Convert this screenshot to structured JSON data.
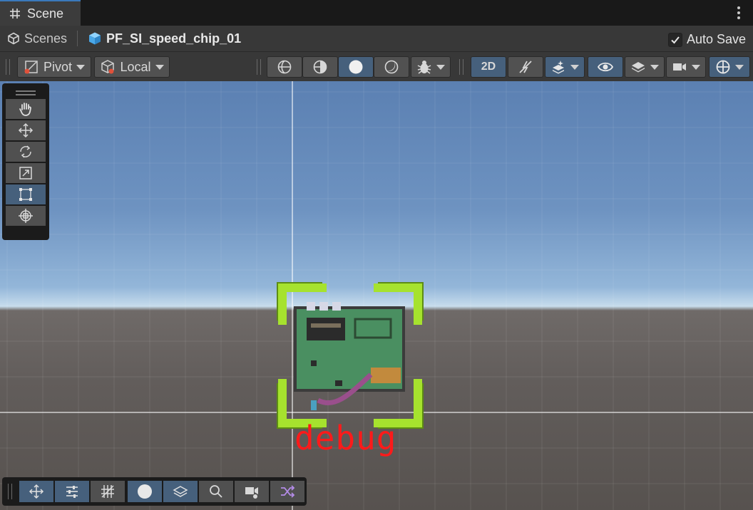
{
  "tab": {
    "title": "Scene",
    "icon": "grid-hash-icon",
    "menu_icon": "kebab-menu-icon"
  },
  "breadcrumb": {
    "scenes_label": "Scenes",
    "prefab_label": "PF_SI_speed_chip_01"
  },
  "autosave": {
    "label": "Auto Save",
    "checked": true
  },
  "toolbar": {
    "pivot_label": "Pivot",
    "local_label": "Local",
    "mode_2d_label": "2D",
    "draw_modes": [
      "wireframe",
      "shaded-wireframe",
      "shaded",
      "unlit"
    ],
    "active_draw_mode": "shaded"
  },
  "tools": {
    "items": [
      "hand-tool",
      "move-tool",
      "rotate-tool",
      "scale-tool",
      "rect-tool",
      "transform-tool"
    ],
    "active": "rect-tool"
  },
  "bottom_overlay": {
    "items": [
      "move-overlay",
      "settings-overlay",
      "grid-overlay",
      "shading-overlay",
      "layers-overlay",
      "search-overlay",
      "camera-overlay",
      "shuffle-overlay"
    ]
  },
  "scene": {
    "debug_text": "debug",
    "selection_color": "#a6e22e",
    "accent": "#46607c"
  }
}
